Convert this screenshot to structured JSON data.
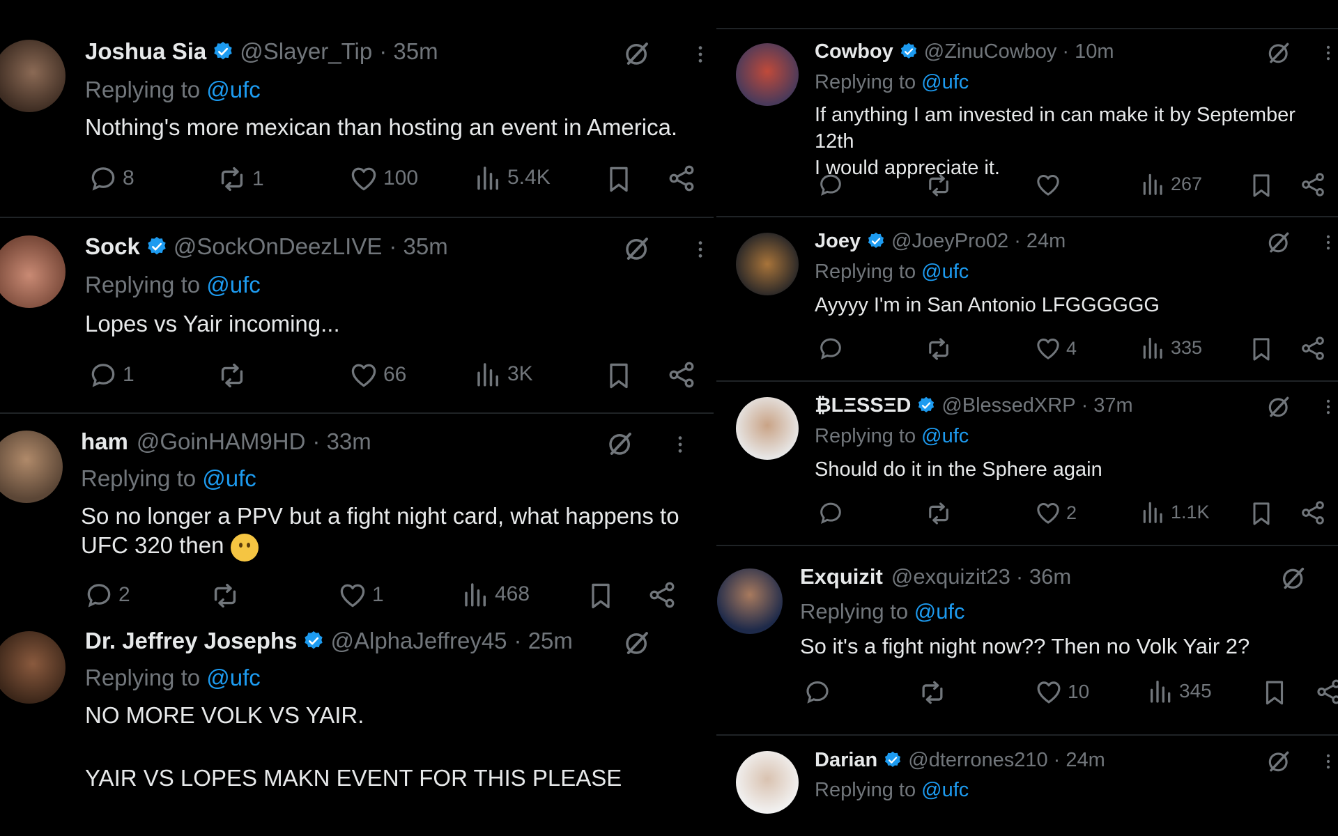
{
  "left_column": [
    {
      "name": "Joshua Sia",
      "verified": true,
      "handle": "@Slayer_Tip",
      "time": "· 35m",
      "replying_prefix": "Replying to",
      "replying_to": "@ufc",
      "text": "Nothing's more mexican than hosting an event in America.",
      "replies": "8",
      "reposts": "1",
      "likes": "100",
      "views": "5.4K"
    },
    {
      "name": "Sock",
      "verified": true,
      "handle": "@SockOnDeezLIVE",
      "time": "· 35m",
      "replying_prefix": "Replying to",
      "replying_to": "@ufc",
      "text": "Lopes vs Yair incoming...",
      "replies": "1",
      "reposts": "",
      "likes": "66",
      "views": "3K"
    },
    {
      "name": "ham",
      "verified": false,
      "handle": "@GoinHAM9HD",
      "time": "· 33m",
      "replying_prefix": "Replying to",
      "replying_to": "@ufc",
      "text_line1": "So no longer a PPV but a fight night card, what happens to",
      "text_line2": "UFC 320 then",
      "emoji": "thinking-face",
      "replies": "2",
      "reposts": "",
      "likes": "1",
      "views": "468"
    },
    {
      "name": "Dr. Jeffrey Josephs",
      "verified": true,
      "handle": "@AlphaJeffrey45",
      "time": "· 25m",
      "replying_prefix": "Replying to",
      "replying_to": "@ufc",
      "text_line1": "NO MORE VOLK VS YAIR.",
      "text_line2": "YAIR VS LOPES MAKN EVENT FOR THIS PLEASE"
    }
  ],
  "right_column": [
    {
      "name": "Cowboy",
      "verified": true,
      "handle": "@ZinuCowboy",
      "time": "· 10m",
      "replying_prefix": "Replying to",
      "replying_to": "@ufc",
      "text_line1": "If anything I am invested in can make it by September 12th",
      "text_line2": "I would appreciate it.",
      "replies": "",
      "reposts": "",
      "likes": "",
      "views": "267"
    },
    {
      "name": "Joey",
      "verified": true,
      "handle": "@JoeyPro02",
      "time": "· 24m",
      "replying_prefix": "Replying to",
      "replying_to": "@ufc",
      "text": "Ayyyy I'm in San Antonio LFGGGGGG",
      "replies": "",
      "reposts": "",
      "likes": "4",
      "views": "335"
    },
    {
      "name": "₿LΞSSΞD",
      "verified": true,
      "handle": "@BlessedXRP",
      "time": "· 37m",
      "replying_prefix": "Replying to",
      "replying_to": "@ufc",
      "text": "Should do it in the Sphere again",
      "replies": "",
      "reposts": "",
      "likes": "2",
      "views": "1.1K"
    },
    {
      "name": "Exquizit",
      "verified": false,
      "handle": "@exquizit23",
      "time": "· 36m",
      "replying_prefix": "Replying to",
      "replying_to": "@ufc",
      "text": "So it's a fight night now?? Then no Volk Yair 2?",
      "replies": "",
      "reposts": "",
      "likes": "10",
      "views": "345"
    },
    {
      "name": "Darian",
      "verified": true,
      "handle": "@dterrones210",
      "time": "· 24m",
      "replying_prefix": "Replying to",
      "replying_to": "@ufc"
    }
  ],
  "colors": {
    "background": "#000000",
    "text": "#e7e9ea",
    "muted": "#71767b",
    "link": "#1d9bf0",
    "verified": "#1d9bf0",
    "divider": "#1f2326"
  }
}
